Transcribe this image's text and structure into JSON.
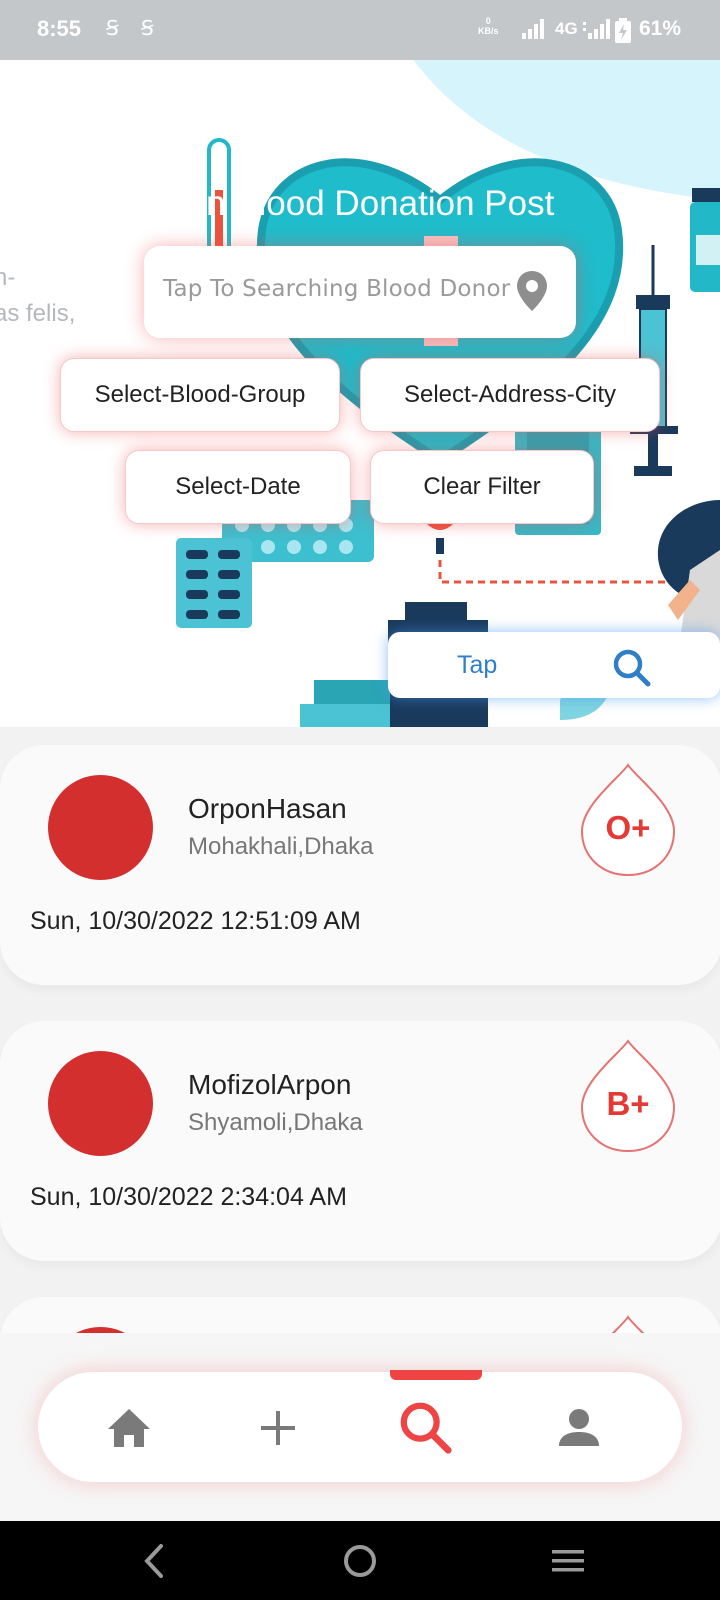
{
  "status_bar": {
    "time": "8:55",
    "sim_icons": "Ꞩ Ꞩ",
    "data_speed_value": "0",
    "data_speed_unit": "KB/s",
    "network_type": "4G",
    "battery": "61%"
  },
  "hero": {
    "title": "n Blood Donation Post",
    "side_text_line1": "n-",
    "side_text_line2": "as felis,",
    "search_placeholder": "Tap To Searching Blood Donor",
    "filters": {
      "blood_group": "Select-Blood-Group",
      "address_city": "Select-Address-City",
      "date": "Select-Date",
      "clear": "Clear Filter"
    },
    "tap_label": "Tap"
  },
  "donors": [
    {
      "name": "OrponHasan",
      "address": "Mohakhali,Dhaka",
      "date": "Sun, 10/30/2022 12:51:09 AM",
      "blood_group": "O+"
    },
    {
      "name": "MofizolArpon",
      "address": "Shyamoli,Dhaka",
      "date": "Sun, 10/30/2022 2:34:04 AM",
      "blood_group": "B+"
    }
  ],
  "bottom_nav": {
    "items": [
      "home-icon",
      "plus-icon",
      "search-icon",
      "person-icon"
    ],
    "active_index": 2
  },
  "colors": {
    "accent_red": "#e53935",
    "avatar_red": "#d32f2f",
    "tap_blue": "#2f7ec8",
    "teal": "#22b8c8"
  }
}
